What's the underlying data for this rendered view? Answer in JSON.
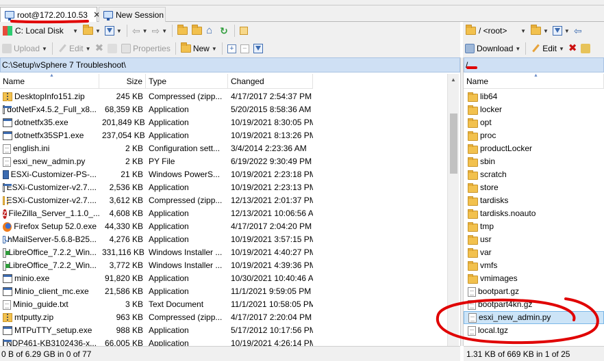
{
  "tabs": [
    {
      "label": "root@172.20.10.53",
      "active": true
    },
    {
      "label": "New Session",
      "active": false
    }
  ],
  "left": {
    "drive_label": "C: Local Disk",
    "toolbar": {
      "upload": "Upload",
      "edit": "Edit",
      "properties": "Properties",
      "new": "New"
    },
    "path": "C:\\Setup\\vSphere 7 Troubleshoot\\",
    "columns": {
      "name": "Name",
      "size": "Size",
      "type": "Type",
      "changed": "Changed"
    },
    "files": [
      {
        "name": "DesktopInfo151.zip",
        "size": "245 KB",
        "type": "Compressed (zipp...",
        "changed": "4/17/2017  2:54:37 PM",
        "icon": "zip"
      },
      {
        "name": "dotNetFx4.5.2_Full_x8...",
        "size": "68,359 KB",
        "type": "Application",
        "changed": "5/20/2015  8:58:36 AM",
        "icon": "exe"
      },
      {
        "name": "dotnetfx35.exe",
        "size": "201,849 KB",
        "type": "Application",
        "changed": "10/19/2021  8:30:05 PM",
        "icon": "exe"
      },
      {
        "name": "dotnetfx35SP1.exe",
        "size": "237,054 KB",
        "type": "Application",
        "changed": "10/19/2021  8:13:26 PM",
        "icon": "exe"
      },
      {
        "name": "english.ini",
        "size": "2 KB",
        "type": "Configuration sett...",
        "changed": "3/4/2014  2:23:36 AM",
        "icon": "doc"
      },
      {
        "name": "esxi_new_admin.py",
        "size": "2 KB",
        "type": "PY File",
        "changed": "6/19/2022  9:30:49 PM",
        "icon": "doc"
      },
      {
        "name": "ESXi-Customizer-PS-...",
        "size": "21 KB",
        "type": "Windows PowerS...",
        "changed": "10/19/2021  2:23:18 PM",
        "icon": "ps"
      },
      {
        "name": "ESXi-Customizer-v2.7....",
        "size": "2,536 KB",
        "type": "Application",
        "changed": "10/19/2021  2:23:13 PM",
        "icon": "exe"
      },
      {
        "name": "ESXi-Customizer-v2.7....",
        "size": "3,612 KB",
        "type": "Compressed (zipp...",
        "changed": "12/13/2021  2:01:37 PM",
        "icon": "zip"
      },
      {
        "name": "FileZilla_Server_1.1.0_...",
        "size": "4,608 KB",
        "type": "Application",
        "changed": "12/13/2021  10:06:56 AM",
        "icon": "zila"
      },
      {
        "name": "Firefox Setup 52.0.exe",
        "size": "44,330 KB",
        "type": "Application",
        "changed": "4/17/2017  2:04:20 PM",
        "icon": "fox"
      },
      {
        "name": "hMailServer-5.6.8-B25...",
        "size": "4,276 KB",
        "type": "Application",
        "changed": "10/19/2021  3:57:15 PM",
        "icon": "mail"
      },
      {
        "name": "LibreOffice_7.2.2_Win...",
        "size": "331,116 KB",
        "type": "Windows Installer ...",
        "changed": "10/19/2021  4:40:27 PM",
        "icon": "msi"
      },
      {
        "name": "LibreOffice_7.2.2_Win...",
        "size": "3,772 KB",
        "type": "Windows Installer ...",
        "changed": "10/19/2021  4:39:36 PM",
        "icon": "msi"
      },
      {
        "name": "minio.exe",
        "size": "91,820 KB",
        "type": "Application",
        "changed": "10/30/2021  10:40:46 AM",
        "icon": "exe"
      },
      {
        "name": "Minio_client_mc.exe",
        "size": "21,586 KB",
        "type": "Application",
        "changed": "11/1/2021  9:59:05 PM",
        "icon": "exe"
      },
      {
        "name": "Minio_guide.txt",
        "size": "3 KB",
        "type": "Text Document",
        "changed": "11/1/2021  10:58:05 PM",
        "icon": "doc"
      },
      {
        "name": "mtputty.zip",
        "size": "963 KB",
        "type": "Compressed (zipp...",
        "changed": "4/17/2017  2:20:04 PM",
        "icon": "zip"
      },
      {
        "name": "MTPuTTY_setup.exe",
        "size": "988 KB",
        "type": "Application",
        "changed": "5/17/2012  10:17:56 PM",
        "icon": "exe"
      },
      {
        "name": "NDP461-KB3102436-x...",
        "size": "66,005 KB",
        "type": "Application",
        "changed": "10/19/2021  4:26:14 PM",
        "icon": "exe"
      }
    ],
    "status": "0 B of 6.29 GB in 0 of 77"
  },
  "right": {
    "location_label": "/ <root>",
    "toolbar": {
      "download": "Download",
      "edit": "Edit"
    },
    "path": "/",
    "columns": {
      "name": "Name"
    },
    "files": [
      {
        "name": "lib64",
        "icon": "folder"
      },
      {
        "name": "locker",
        "icon": "folder"
      },
      {
        "name": "opt",
        "icon": "folder"
      },
      {
        "name": "proc",
        "icon": "folder"
      },
      {
        "name": "productLocker",
        "icon": "folder"
      },
      {
        "name": "sbin",
        "icon": "folder"
      },
      {
        "name": "scratch",
        "icon": "folder"
      },
      {
        "name": "store",
        "icon": "folder"
      },
      {
        "name": "tardisks",
        "icon": "folder"
      },
      {
        "name": "tardisks.noauto",
        "icon": "folder"
      },
      {
        "name": "tmp",
        "icon": "folder"
      },
      {
        "name": "usr",
        "icon": "folder"
      },
      {
        "name": "var",
        "icon": "folder"
      },
      {
        "name": "vmfs",
        "icon": "folder"
      },
      {
        "name": "vmimages",
        "icon": "folder"
      },
      {
        "name": "bootpart.gz",
        "icon": "doc"
      },
      {
        "name": "bootpart4kn.gz",
        "icon": "doc"
      },
      {
        "name": "esxi_new_admin.py",
        "icon": "doc",
        "selected": true
      },
      {
        "name": "local.tgz",
        "icon": "doc"
      }
    ],
    "status": "1.31 KB of 669 KB in 1 of 25"
  },
  "colors": {
    "path_bar": "#cfe0f4",
    "selection": "#cce4f7",
    "annotation_red": "#e00000"
  }
}
